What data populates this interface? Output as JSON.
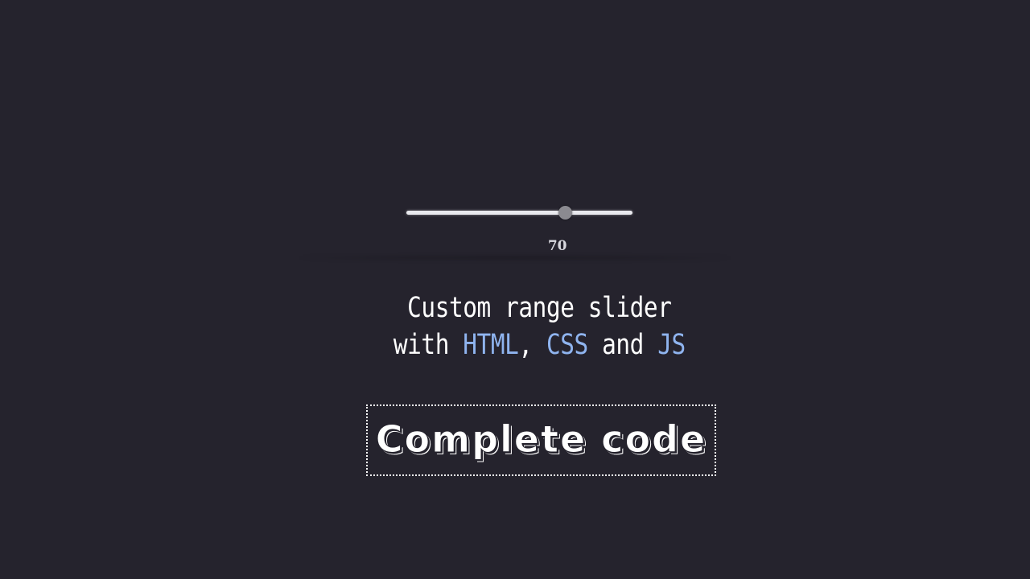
{
  "slider": {
    "value": 70,
    "min": 0,
    "max": 100,
    "value_label": "70",
    "track_color": "#e9e9ee",
    "thumb_color": "#8b8a90"
  },
  "headline": {
    "line1": "Custom range slider",
    "line2_prefix": "with ",
    "html": "HTML",
    "comma": ", ",
    "css": "CSS",
    "and": " and ",
    "js": "JS",
    "highlight_color": "#8fb4ef"
  },
  "cta": {
    "label": "Complete code"
  },
  "colors": {
    "background": "#25232d",
    "text": "#ffffff"
  }
}
